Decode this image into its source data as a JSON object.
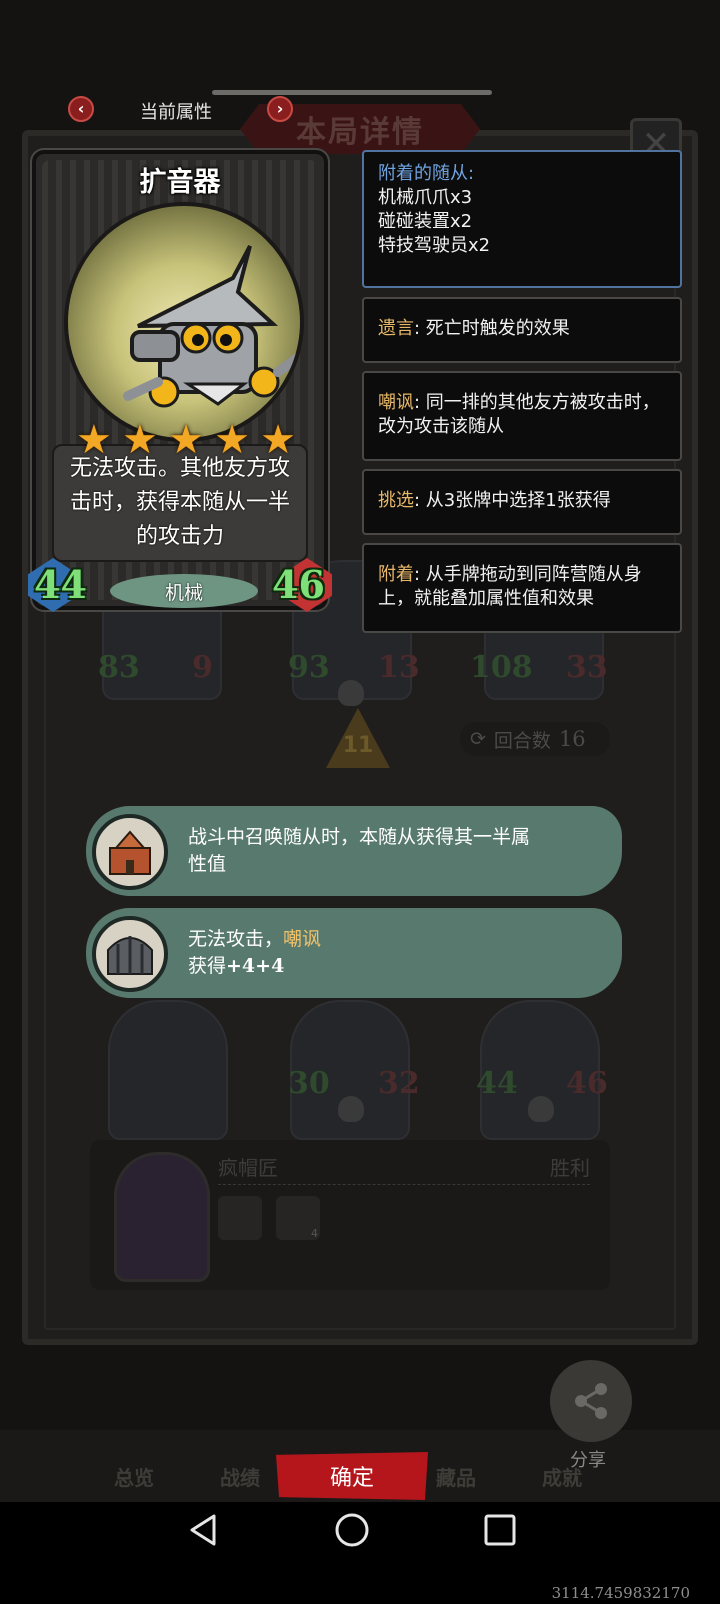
{
  "header": {
    "title": "当前属性",
    "prev_icon": "chevron-left-icon",
    "next_icon": "chevron-right-icon",
    "background_title": "本局详情"
  },
  "card": {
    "name": "扩音器",
    "stars": 5,
    "description": "无法攻击。其他友方攻击时，获得本随从一半的攻击力",
    "tribe": "机械",
    "attack": "44",
    "health": "46"
  },
  "keywords": {
    "attached_title": "附着的随从:",
    "attached_items": [
      "机械爪爪x3",
      "碰碰装置x2",
      "特技驾驶员x2"
    ],
    "deathrattle_label": "遗言",
    "deathrattle_text": ": 死亡时触发的效果",
    "taunt_label": "嘲讽",
    "taunt_text": ": 同一排的其他友方被攻击时，改为攻击该随从",
    "discover_label": "挑选",
    "discover_text": ": 从3张牌中选择1张获得",
    "attach_label": "附着",
    "attach_text": ": 从手牌拖动到同阵营随从身上，就能叠加属性值和效果"
  },
  "skills": [
    {
      "text": "战斗中召唤随从时，本随从获得其一半属性值",
      "icon": "castle-icon"
    },
    {
      "text_pre": "无法攻击，",
      "text_hl": "嘲讽",
      "text_line2": "获得",
      "text_num": "+4+4",
      "icon": "cage-icon"
    }
  ],
  "background": {
    "minions": [
      {
        "atk": "83",
        "hp": "9"
      },
      {
        "atk": "93",
        "hp": "13"
      },
      {
        "atk": "108",
        "hp": "33"
      },
      {
        "atk": "30",
        "hp": "32"
      },
      {
        "atk": "44",
        "hp": "46"
      }
    ],
    "tier": "11",
    "round_label": "回合数",
    "round_value": "16",
    "opponent_name": "疯帽匠",
    "result": "胜利",
    "icon_badge": "4"
  },
  "bottom": {
    "share_label": "分享",
    "tabs": [
      "总览",
      "战绩",
      "藏品",
      "成就"
    ],
    "confirm_label": "确定"
  },
  "system": {
    "coords": "3114.7459832170"
  },
  "colors": {
    "accent_red": "#b4161c",
    "keyword_gold": "#e8b96a",
    "attached_blue": "#6fa3e0",
    "stat_green": "#7fe079",
    "skill_bubble": "#58796e"
  }
}
